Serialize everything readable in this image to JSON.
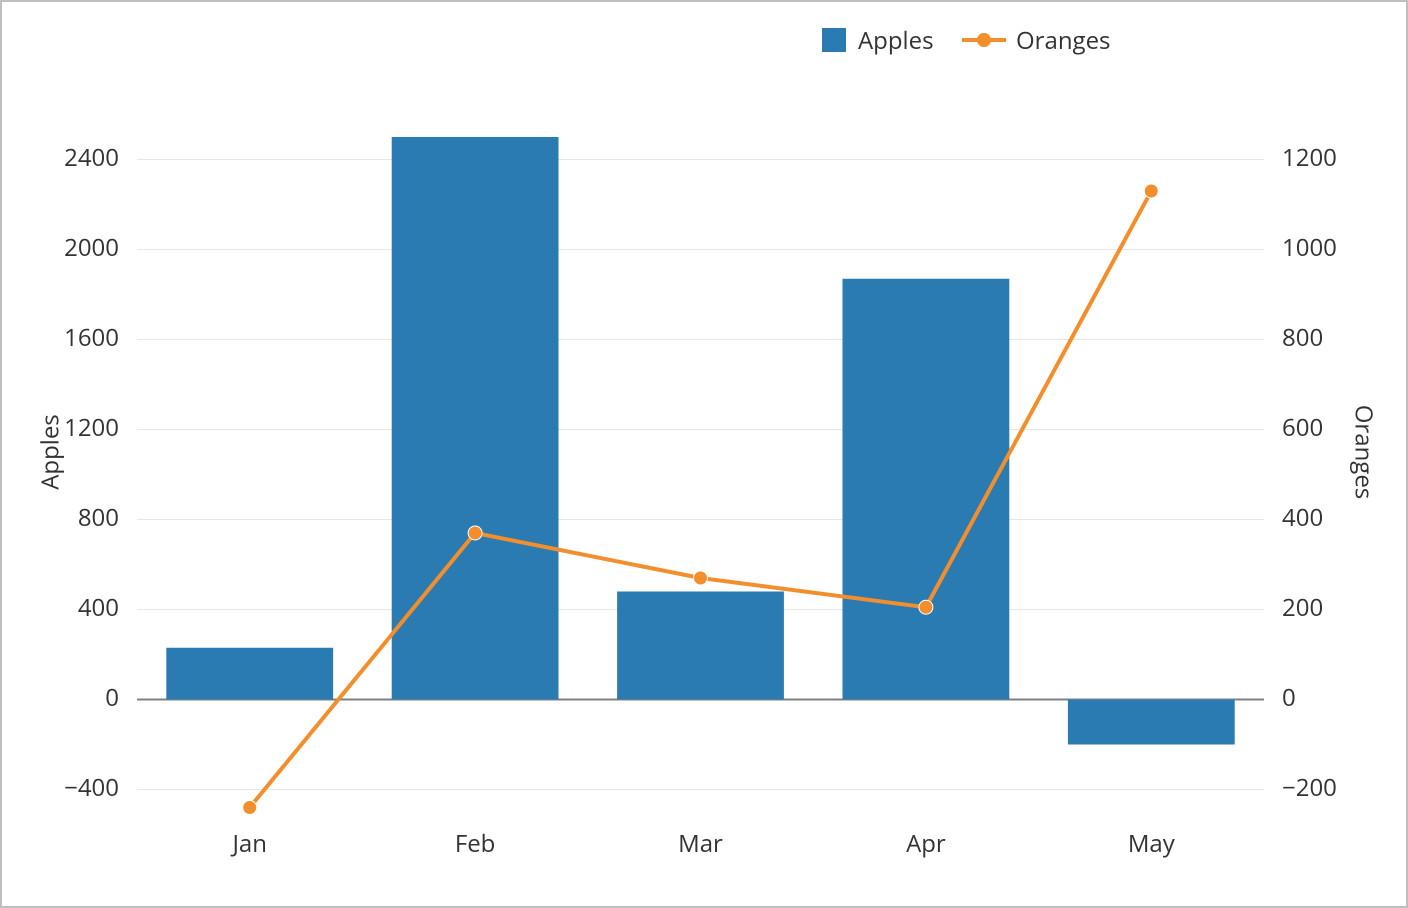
{
  "chart_data": {
    "type": "bar",
    "categories": [
      "Jan",
      "Feb",
      "Mar",
      "Apr",
      "May"
    ],
    "series": [
      {
        "name": "Apples",
        "role": "bars",
        "axis": "left",
        "values": [
          230,
          2500,
          480,
          1870,
          -200
        ]
      },
      {
        "name": "Oranges",
        "role": "line",
        "axis": "right",
        "values": [
          -240,
          370,
          270,
          205,
          1130
        ]
      }
    ],
    "title": "",
    "xlabel": "",
    "y_left": {
      "label": "Apples",
      "min": -400,
      "max": 2400,
      "step": 400
    },
    "y_right": {
      "label": "Oranges",
      "min": -200,
      "max": 1200,
      "step": 200
    },
    "legend": {
      "items": [
        "Apples",
        "Oranges"
      ],
      "position": "top"
    },
    "colors": {
      "bars": "#2b7bb3",
      "line": "#f28e2c",
      "grid": "#e6e6e6",
      "axis_text": "#333333"
    }
  }
}
